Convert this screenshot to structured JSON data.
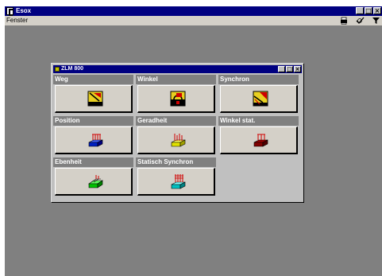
{
  "app": {
    "title": "Esox",
    "menu": [
      "Fenster"
    ],
    "controls": [
      "_",
      "□",
      "×"
    ],
    "toolbar_icons": [
      "print-icon",
      "check-icon",
      "funnel-icon"
    ]
  },
  "child_window": {
    "title": "ZLM 800",
    "controls": [
      "_",
      "□",
      "×"
    ],
    "tiles": [
      {
        "label": "Weg",
        "icon": "weg-icon"
      },
      {
        "label": "Winkel",
        "icon": "winkel-icon"
      },
      {
        "label": "Synchron",
        "icon": "synchron-icon"
      },
      {
        "label": "Position",
        "icon": "position-icon"
      },
      {
        "label": "Geradheit",
        "icon": "geradheit-icon"
      },
      {
        "label": "Winkel stat.",
        "icon": "winkel-stat-icon"
      },
      {
        "label": "Ebenheit",
        "icon": "ebenheit-icon"
      },
      {
        "label": "Statisch Synchron",
        "icon": "statisch-synchron-icon"
      }
    ]
  },
  "colors": {
    "titlebar": "#000080",
    "workspace": "#808080",
    "tile_header": "#808080",
    "tile_button": "#d4d0c8"
  }
}
